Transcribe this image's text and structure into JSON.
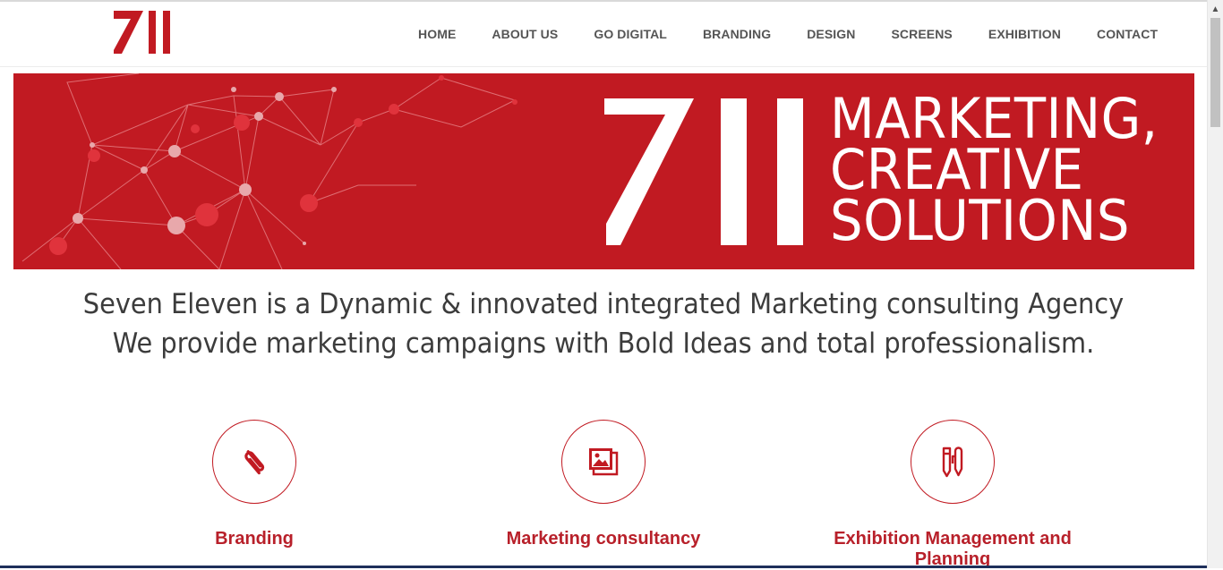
{
  "brand": {
    "logo_text": "711",
    "accent_color": "#c11a22"
  },
  "nav": {
    "items": [
      {
        "label": "HOME"
      },
      {
        "label": "ABOUT US"
      },
      {
        "label": "GO DIGITAL"
      },
      {
        "label": "BRANDING"
      },
      {
        "label": "DESIGN"
      },
      {
        "label": "SCREENS"
      },
      {
        "label": "EXHIBITION"
      },
      {
        "label": "CONTACT"
      }
    ]
  },
  "banner": {
    "numeral": "711",
    "tagline": [
      "MARKETING,",
      "CREATIVE",
      "SOLUTIONS"
    ]
  },
  "intro": {
    "line1": "Seven Eleven is a Dynamic & innovated integrated Marketing consulting Agency",
    "line2": "We provide marketing campaigns with Bold Ideas and total professionalism."
  },
  "services": [
    {
      "title": "Branding",
      "icon": "paperclip-icon"
    },
    {
      "title": "Marketing consultancy",
      "icon": "images-icon"
    },
    {
      "title": "Exhibition Management and Planning",
      "icon": "pen-pencil-icon"
    }
  ]
}
